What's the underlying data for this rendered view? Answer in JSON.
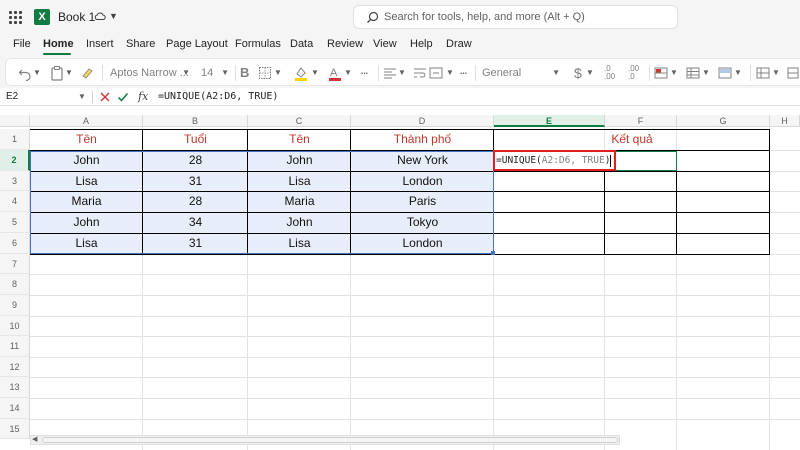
{
  "app": {
    "title": "Book 1"
  },
  "search": {
    "placeholder": "Search for tools, help, and more (Alt + Q)"
  },
  "menu": {
    "tabs": [
      "File",
      "Home",
      "Insert",
      "Share",
      "Page Layout",
      "Formulas",
      "Data",
      "Review",
      "View",
      "Help",
      "Draw"
    ],
    "active": "Home"
  },
  "ribbon": {
    "font_name": "Aptos Narrow ...",
    "font_size": "14",
    "bold_label": "B",
    "number_format": "General"
  },
  "formula_bar": {
    "name_box": "E2",
    "fx_label": "fx",
    "formula": "=UNIQUE(A2:D6, TRUE)"
  },
  "sheet": {
    "columns": [
      "A",
      "B",
      "C",
      "D",
      "E",
      "F",
      "G",
      "H"
    ],
    "selected_column": "E",
    "rows": [
      "1",
      "2",
      "3",
      "4",
      "5",
      "6",
      "7",
      "8",
      "9",
      "10",
      "11",
      "12",
      "13",
      "14",
      "15"
    ],
    "selected_row": "2",
    "header_row": [
      "Tên",
      "Tuổi",
      "Tên",
      "Thành phố"
    ],
    "result_header": "Kết quả",
    "data": [
      [
        "John",
        "28",
        "John",
        "New York"
      ],
      [
        "Lisa",
        "31",
        "Lisa",
        "London"
      ],
      [
        "Maria",
        "28",
        "Maria",
        "Paris"
      ],
      [
        "John",
        "34",
        "John",
        "Tokyo"
      ],
      [
        "Lisa",
        "31",
        "Lisa",
        "London"
      ]
    ],
    "editing": {
      "cell": "E2",
      "prefix": "=UNIQUE(",
      "ref": "A2:D6, TRUE",
      "suffix": ")"
    }
  },
  "colors": {
    "accent": "#107c41",
    "header_text": "#c0392b",
    "range_fill": "#e8eef9",
    "range_border": "#4472c4",
    "highlight_box": "#e01f1f"
  }
}
